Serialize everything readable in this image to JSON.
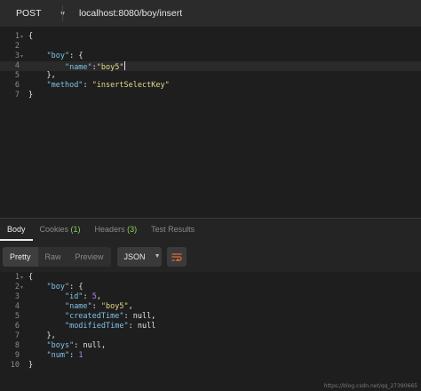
{
  "request": {
    "method": "POST",
    "url": "localhost:8080/boy/insert"
  },
  "request_body": {
    "line_numbers": [
      "1",
      "2",
      "3",
      "4",
      "5",
      "6",
      "7"
    ],
    "lines": [
      "{",
      "",
      "    \"boy\": {",
      "        \"name\":\"boy5\"",
      "    },",
      "    \"method\": \"insertSelectKey\"",
      "}"
    ]
  },
  "response_tabs": [
    {
      "label": "Body",
      "count": ""
    },
    {
      "label": "Cookies",
      "count": "(1)"
    },
    {
      "label": "Headers",
      "count": "(3)"
    },
    {
      "label": "Test Results",
      "count": ""
    }
  ],
  "response_toolbar": {
    "views": [
      "Pretty",
      "Raw",
      "Preview"
    ],
    "format": "JSON"
  },
  "response_body": {
    "line_numbers": [
      "1",
      "2",
      "3",
      "4",
      "5",
      "6",
      "7",
      "8",
      "9",
      "10"
    ],
    "lines": [
      "{",
      "    \"boy\": {",
      "        \"id\": 5,",
      "        \"name\": \"boy5\",",
      "        \"createdTime\": null,",
      "        \"modifiedTime\": null",
      "    },",
      "    \"boys\": null,",
      "    \"num\": 1",
      "}"
    ]
  },
  "watermark": "https://blog.csdn.net/qq_27390665",
  "colors": {
    "background": "#1e1e1e",
    "key": "#7fc3e4",
    "string": "#e6d98a",
    "number": "#ae81ff",
    "badge_count": "#8fcf5a",
    "wrap_icon": "#e2683c"
  },
  "icons": [
    "method-chevron-down-icon",
    "format-chevron-down-icon",
    "wrap-lines-icon",
    "fold-arrow-icon"
  ]
}
